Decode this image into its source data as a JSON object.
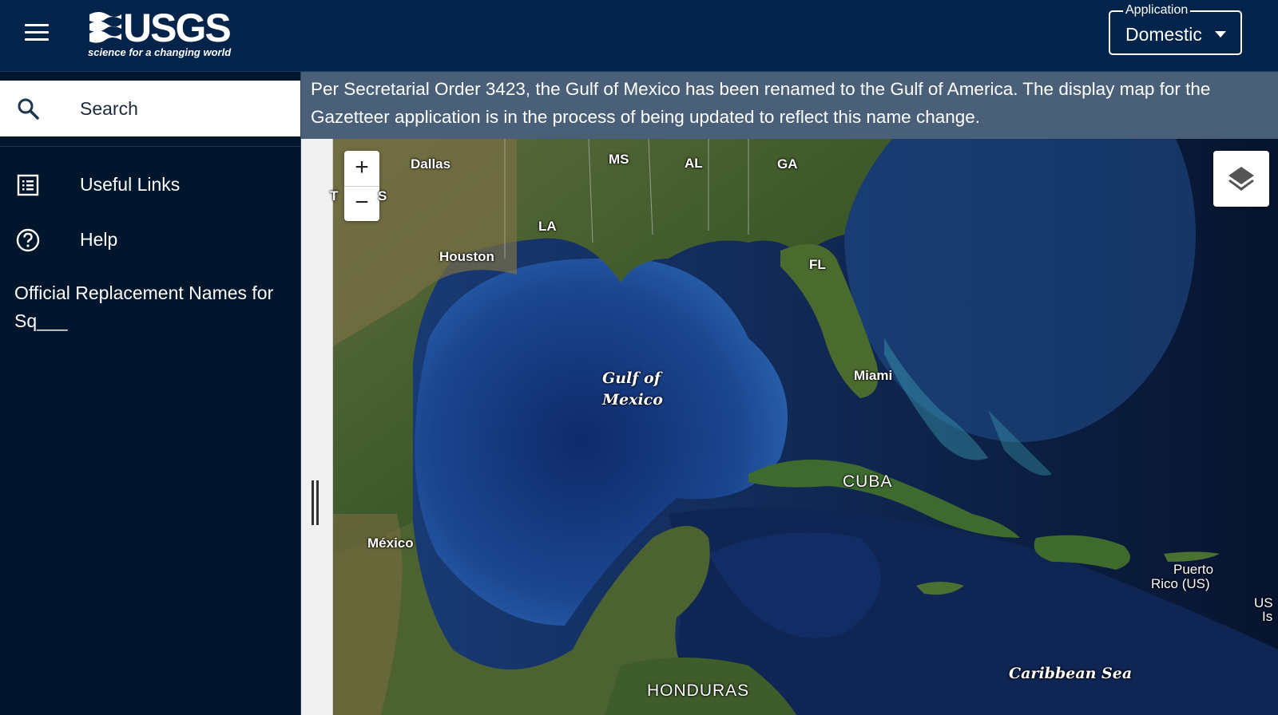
{
  "header": {
    "logo_word": "USGS",
    "logo_tagline": "science for a changing world",
    "application_label": "Application",
    "application_value": "Domestic"
  },
  "sidebar": {
    "search_label": "Search",
    "items": [
      {
        "label": "Useful Links",
        "icon": "list-icon"
      },
      {
        "label": "Help",
        "icon": "help-icon"
      }
    ],
    "replacement_names_link": "Official Replacement Names for Sq___"
  },
  "notice": {
    "text": "Per Secretarial Order 3423, the Gulf of Mexico has been renamed to the Gulf of America.   The display map for the Gazetteer application is in the process of being updated to reflect this name change."
  },
  "map": {
    "zoom_in": "+",
    "zoom_out": "−",
    "labels": {
      "dallas": "Dallas",
      "ms": "MS",
      "al": "AL",
      "ga": "GA",
      "la": "LA",
      "houston": "Houston",
      "fl": "FL",
      "gulf_line1": "Gulf of",
      "gulf_line2": "Mexico",
      "miami": "Miami",
      "cuba": "CUBA",
      "mexico": "México",
      "puerto_rico_line1": "Puerto",
      "puerto_rico_line2": "Rico (US)",
      "us_vi_line1": "US",
      "us_vi_line2": "Is",
      "caribbean": "Caribbean Sea",
      "honduras": "HONDURAS",
      "texas_partial": "T",
      "texas_partial2": "S"
    }
  }
}
